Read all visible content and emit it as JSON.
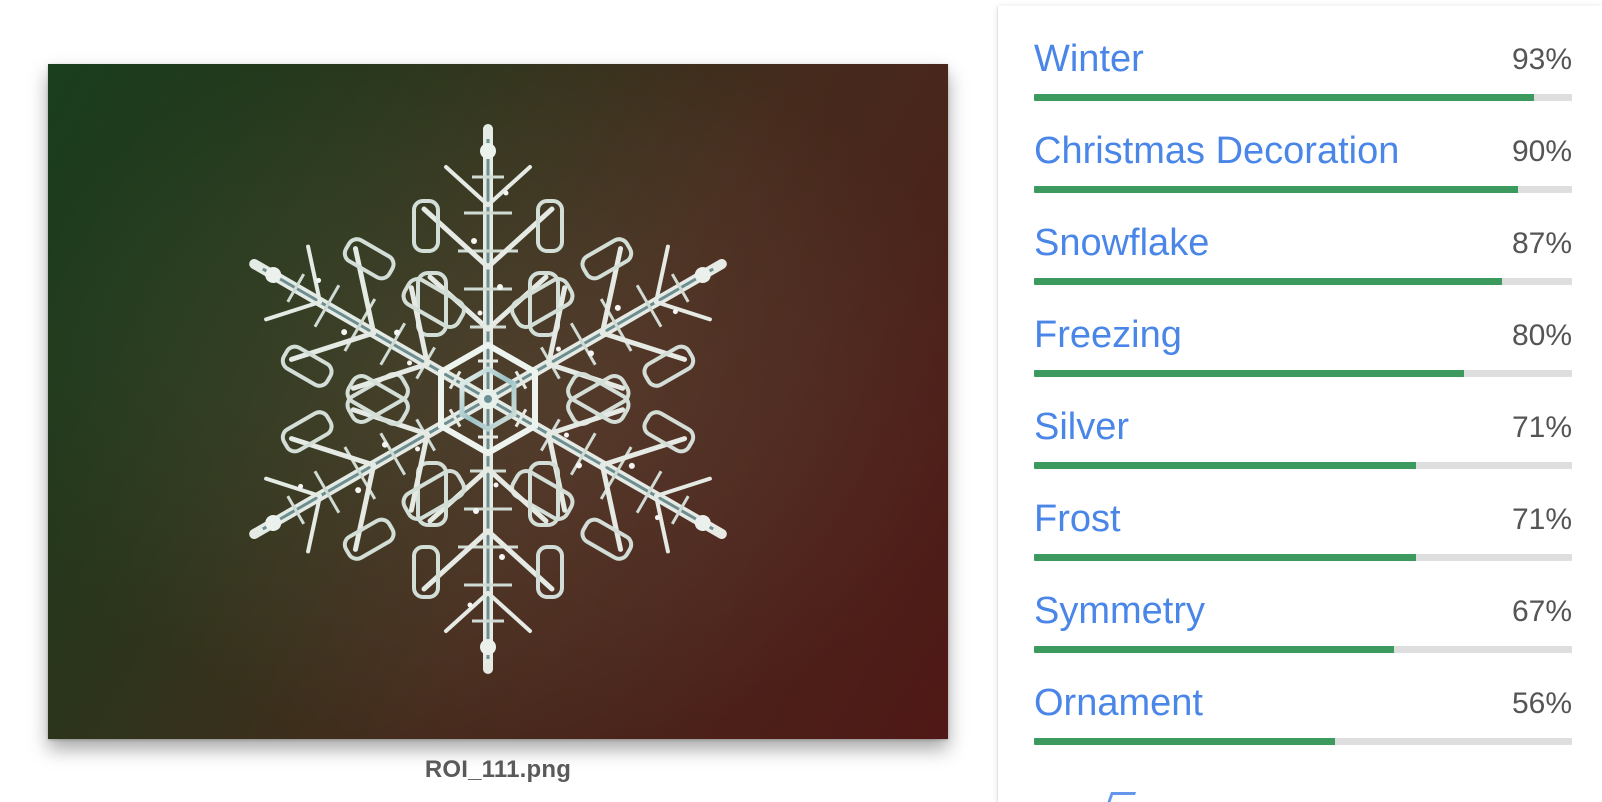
{
  "image": {
    "filename": "ROI_111.png",
    "gradient_colors": [
      "#1b4320",
      "#571a18"
    ]
  },
  "labels": [
    {
      "name": "Winter",
      "score": "93%",
      "value": 0.93
    },
    {
      "name": "Christmas Decoration",
      "score": "90%",
      "value": 0.9
    },
    {
      "name": "Snowflake",
      "score": "87%",
      "value": 0.87
    },
    {
      "name": "Freezing",
      "score": "80%",
      "value": 0.8
    },
    {
      "name": "Silver",
      "score": "71%",
      "value": 0.71
    },
    {
      "name": "Frost",
      "score": "71%",
      "value": 0.71
    },
    {
      "name": "Symmetry",
      "score": "67%",
      "value": 0.67
    },
    {
      "name": "Ornament",
      "score": "56%",
      "value": 0.56
    }
  ],
  "colors": {
    "label": "#4a86e8",
    "bar": "#3d9a5e",
    "track": "#dedede",
    "score": "#555555"
  }
}
